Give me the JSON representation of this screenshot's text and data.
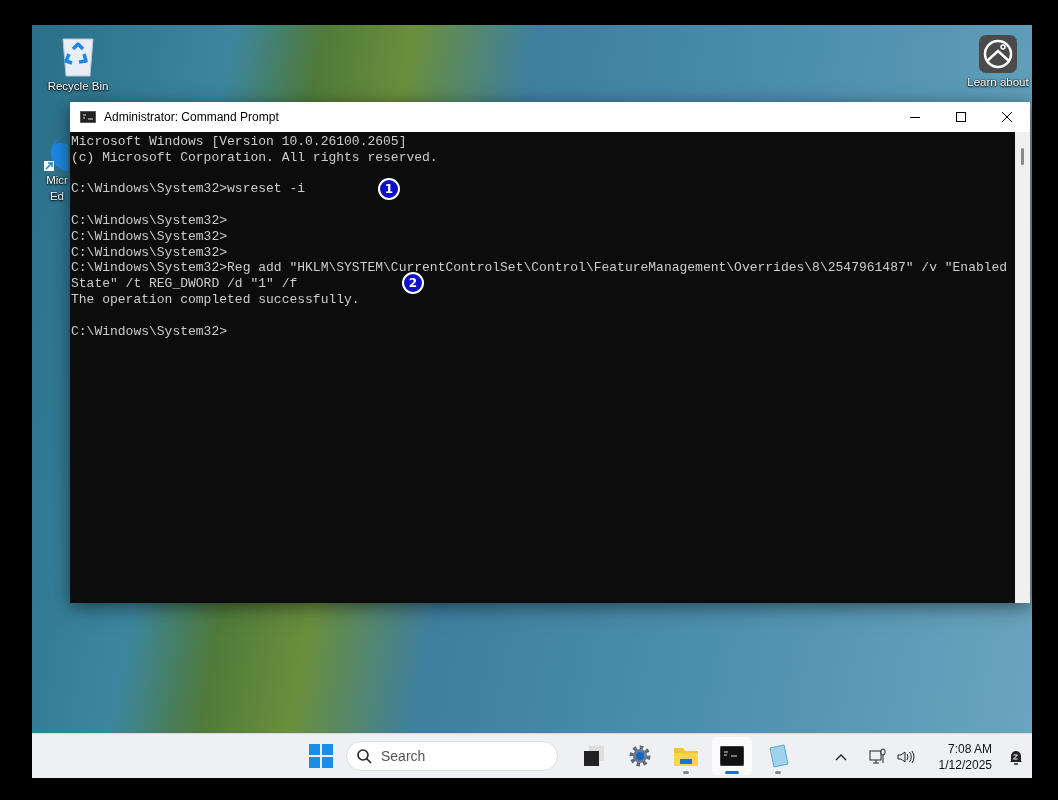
{
  "desktop_icons": [
    {
      "kind": "recycle-bin",
      "label_lines": [
        "Recycle Bin"
      ]
    },
    {
      "kind": "browser",
      "label_lines": [
        "Micr",
        "Ed"
      ]
    },
    {
      "kind": "picture",
      "label_lines": [
        "Learn about"
      ]
    }
  ],
  "window": {
    "title": "Administrator: Command Prompt",
    "console_blocks": [
      [
        "Microsoft Windows [Version 10.0.26100.2605]",
        "(c) Microsoft Corporation. All rights reserved."
      ],
      [
        "C:\\Windows\\System32>wsreset -i"
      ],
      [
        "C:\\Windows\\System32>",
        "C:\\Windows\\System32>",
        "C:\\Windows\\System32>",
        "C:\\Windows\\System32>Reg add \"HKLM\\SYSTEM\\CurrentControlSet\\Control\\FeatureManagement\\Overrides\\8\\2547961487\" /v \"Enabled",
        "State\" /t REG_DWORD /d \"1\" /f",
        "The operation completed successfully."
      ],
      [
        "C:\\Windows\\System32>"
      ]
    ],
    "annotations": [
      "1",
      "2"
    ]
  },
  "taskbar": {
    "search": {
      "placeholder": "Search"
    },
    "apps": [
      {
        "kind": "task-view",
        "running": false,
        "selected": false
      },
      {
        "kind": "settings",
        "running": false,
        "selected": false
      },
      {
        "kind": "folder",
        "running": true,
        "selected": false
      },
      {
        "kind": "terminal",
        "running": true,
        "selected": true
      },
      {
        "kind": "notepad",
        "running": true,
        "selected": false
      }
    ],
    "time": "7:08 AM",
    "date": "1/12/2025"
  }
}
